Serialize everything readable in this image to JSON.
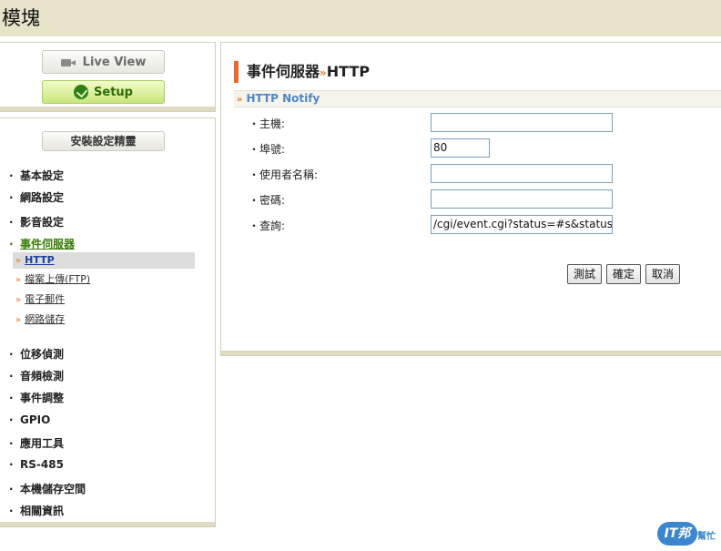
{
  "window": {
    "title": "模塊"
  },
  "sidebar": {
    "live_view_label": "Live View",
    "setup_label": "Setup",
    "wizard_label": "安裝設定精靈",
    "items": [
      {
        "label": "基本設定"
      },
      {
        "label": "網路設定"
      },
      {
        "label": "影音設定"
      },
      {
        "label": "事件伺服器"
      },
      {
        "label": "位移偵測"
      },
      {
        "label": "音頻檢測"
      },
      {
        "label": "事件調整"
      },
      {
        "label": "GPIO"
      },
      {
        "label": "應用工具"
      },
      {
        "label": "RS-485"
      },
      {
        "label": "本機儲存空間"
      },
      {
        "label": "相關資訊"
      }
    ],
    "subitems": [
      {
        "label": "HTTP"
      },
      {
        "label": "檔案上傳(FTP)"
      },
      {
        "label": "電子郵件"
      },
      {
        "label": "網路儲存"
      }
    ],
    "bullet": "·",
    "sub_arrow": "»"
  },
  "main": {
    "title_prefix": "事件伺服器",
    "title_sep": "»",
    "title_suffix": "HTTP",
    "section": "HTTP Notify",
    "fields": [
      {
        "label": "・主機:",
        "value": ""
      },
      {
        "label": "・埠號:",
        "value": "80"
      },
      {
        "label": "・使用者名稱:",
        "value": ""
      },
      {
        "label": "・密碼:",
        "value": ""
      },
      {
        "label": "・查詢:",
        "value": "/cgi/event.cgi?status=#s&statusid"
      }
    ],
    "buttons": {
      "test": "測試",
      "ok": "確定",
      "cancel": "取消"
    }
  },
  "watermark": {
    "logo_text": "IT邦",
    "logo_sub": "幫忙"
  },
  "colors": {
    "accent_orange": "#e86b2c",
    "setup_green": "#c8e67c",
    "section_blue": "#4f86c6",
    "link_blue": "#1b3fa0",
    "band": "#dedbc2"
  }
}
